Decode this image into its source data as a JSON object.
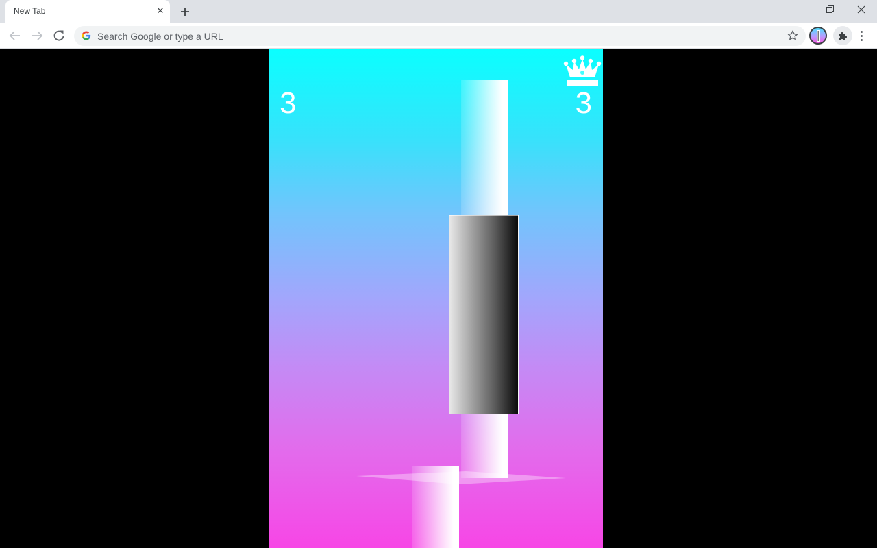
{
  "browser": {
    "tab": {
      "title": "New Tab",
      "close_icon": "close-icon"
    },
    "new_tab_icon": "plus-icon",
    "window_controls": {
      "minimize": "minimize-icon",
      "maximize": "restore-icon",
      "close": "close-icon"
    },
    "nav": {
      "back": "arrow-left-icon",
      "forward": "arrow-right-icon",
      "reload": "reload-icon"
    },
    "omnibox": {
      "placeholder": "Search Google or type a URL",
      "value": "",
      "search_engine_icon": "google-g-icon",
      "bookmark_icon": "star-icon"
    },
    "profile_icon": "profile-avatar",
    "extensions_icon": "puzzle-icon",
    "menu_icon": "kebab-menu-icon"
  },
  "game": {
    "score": "3",
    "best_score": "3",
    "best_icon": "crown-icon",
    "colors": {
      "background_top": "#0affff",
      "background_bottom": "#f746e6",
      "score_text": "#ffffff",
      "block_light": "#e8e8e8",
      "block_dark": "#0a0a0a"
    }
  }
}
